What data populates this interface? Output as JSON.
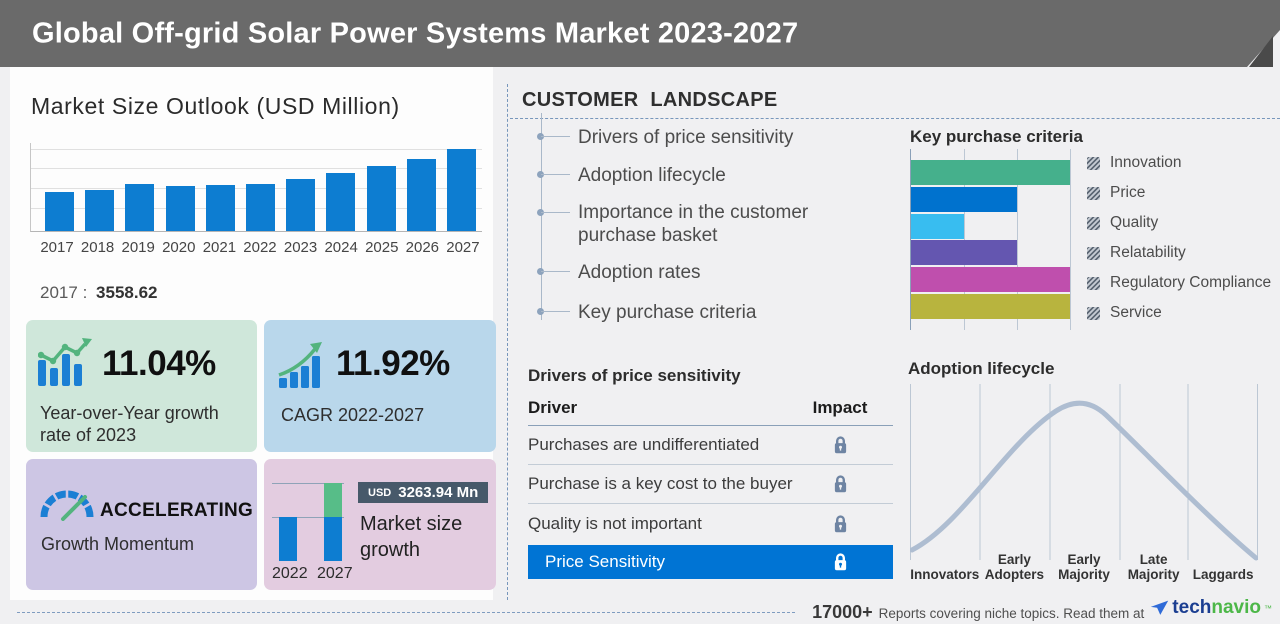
{
  "header": {
    "title": "Global Off-grid Solar Power Systems Market 2023-2027"
  },
  "market_size_panel": {
    "title": "Market Size Outlook (USD Million)",
    "note_year": "2017",
    "note_sep": ":",
    "note_value": "3558.62"
  },
  "chart_data": [
    {
      "id": "market-size-outlook",
      "type": "bar",
      "title": "Market Size Outlook (USD Million)",
      "ylabel": "USD Million",
      "categories": [
        "2017",
        "2018",
        "2019",
        "2020",
        "2021",
        "2022",
        "2023",
        "2024",
        "2025",
        "2026",
        "2027"
      ],
      "values": [
        3558.62,
        3810,
        4290,
        4140,
        4265,
        4320,
        4795,
        5305,
        5985,
        6665,
        7580
      ],
      "labeled_point": {
        "category": "2017",
        "value": 3558.62
      },
      "ylim": [
        0,
        8200
      ],
      "grid": true,
      "bar_color": "#0d7dd1"
    },
    {
      "id": "key-purchase-criteria",
      "type": "bar",
      "orientation": "horizontal",
      "title": "Key purchase criteria",
      "categories": [
        "Innovation",
        "Price",
        "Quality",
        "Relatability",
        "Regulatory Compliance",
        "Service"
      ],
      "values": [
        3,
        2,
        1,
        2,
        3,
        3
      ],
      "xlim": [
        0,
        3
      ],
      "colors": [
        "#45b08c",
        "#0072ce",
        "#38bdf0",
        "#6456b0",
        "#bf4fad",
        "#b8b43e"
      ],
      "legend_position": "right",
      "grid": true
    },
    {
      "id": "market-size-growth",
      "type": "bar",
      "title": "Market size growth",
      "categories": [
        "2022",
        "2027"
      ],
      "values": [
        4317,
        7581
      ],
      "increment_currency": "USD",
      "increment_value": "3263.94 Mn",
      "base_color": "#0d7dd1",
      "increment_color": "#57bd88"
    },
    {
      "id": "adoption-lifecycle",
      "type": "line",
      "title": "Adoption lifecycle",
      "categories": [
        "Innovators",
        "Early Adopters",
        "Early Majority",
        "Late Majority",
        "Laggards"
      ],
      "x_pct": [
        0,
        10,
        20,
        30,
        40,
        48,
        60,
        70,
        80,
        90,
        100
      ],
      "y_pct": [
        4,
        18,
        42,
        70,
        92,
        100,
        90,
        68,
        45,
        22,
        2
      ],
      "line_color": "#aebdd1",
      "grid": true
    }
  ],
  "stats": {
    "yoy": {
      "value": "11.04%",
      "label": "Year-over-Year growth rate of 2023",
      "bg": "#cfe7da"
    },
    "cagr": {
      "value": "11.92%",
      "label": "CAGR 2022-2027",
      "bg": "#b9d7eb"
    },
    "momentum": {
      "value": "ACCELERATING",
      "label": "Growth Momentum",
      "bg": "#cdc6e4"
    },
    "incremental": {
      "bg": "#e3cce0"
    }
  },
  "customer_landscape": {
    "title": "CUSTOMER LANDSCAPE",
    "items": [
      "Drivers of price sensitivity",
      "Adoption lifecycle",
      "Importance in the customer purchase basket",
      "Adoption rates",
      "Key purchase criteria"
    ]
  },
  "price_sensitivity": {
    "title": "Drivers of price sensitivity",
    "columns": {
      "driver": "Driver",
      "impact": "Impact"
    },
    "rows": [
      "Purchases are undifferentiated",
      "Purchase is a key cost to the buyer",
      "Quality is not important"
    ],
    "highlight_row": "Price Sensitivity",
    "impact_icon": "lock-icon",
    "highlight_color": "#0074d4",
    "lock_color": "#6e84a3"
  },
  "footer": {
    "count": "17000+",
    "message": "Reports covering niche topics. Read them at",
    "brand": {
      "part1": "tech",
      "part2": "navio",
      "tm": "™"
    }
  }
}
